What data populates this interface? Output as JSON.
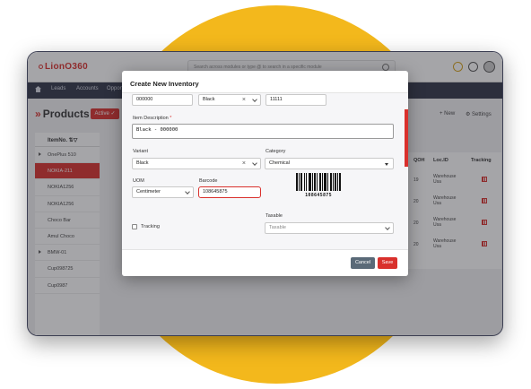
{
  "app": {
    "logo": "LionO360",
    "search_placeholder": "Search across modules or type @ to search in a specific module",
    "nav": [
      "Leads",
      "Accounts",
      "Opport"
    ],
    "page_title": "Products",
    "status_button": "Active",
    "new_label": "New",
    "settings_label": "Settings"
  },
  "list": {
    "header": "ItemNo.",
    "items": [
      "OnePlus 510",
      "NOKIA-211",
      "NOKIA1256",
      "NOKIA1256",
      "Choco Bar",
      "Amul Choco",
      "BMW-01",
      "Cup098725",
      "Cup0987"
    ],
    "selected_index": 1
  },
  "table": {
    "headers": [
      "QOH",
      "Loc.ID",
      "Tracking"
    ],
    "rows": [
      {
        "qoh": "19",
        "loc": "Warehouse Usa"
      },
      {
        "qoh": "20",
        "loc": "Warehouse Usa"
      },
      {
        "qoh": "20",
        "loc": "Warehouse Usa"
      },
      {
        "qoh": "20",
        "loc": "Warehouse Usa"
      }
    ]
  },
  "modal": {
    "title": "Create New Inventory",
    "top_row": {
      "field1": "000000",
      "field2": "Black",
      "field3": "11111"
    },
    "item_description_label": "Item Description",
    "item_description_value": "Black - 000000",
    "variant_label": "Variant",
    "variant_value": "Black",
    "category_label": "Category",
    "category_value": "Chemical",
    "uom_label": "UOM",
    "uom_value": "Centimeter",
    "barcode_label": "Barcode",
    "barcode_value": "108645875",
    "barcode_image_text": "108645875",
    "tracking_label": "Tracking",
    "taxable_label": "Taxable",
    "taxable_placeholder": "Taxable",
    "cancel_label": "Cancel",
    "save_label": "Save"
  },
  "colors": {
    "accent": "#d9302c",
    "nav": "#2f3447",
    "backdrop": "#f3b81c",
    "cancel": "#5a6a78"
  }
}
